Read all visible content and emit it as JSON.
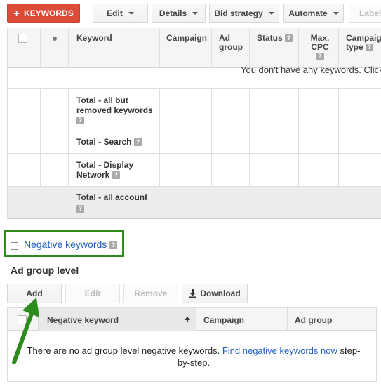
{
  "toolbar": {
    "keywords_label": "KEYWORDS",
    "edit_label": "Edit",
    "details_label": "Details",
    "bid_strategy_label": "Bid strategy",
    "automate_label": "Automate",
    "labels_label": "Labels"
  },
  "keywords_table": {
    "columns": {
      "keyword": "Keyword",
      "campaign": "Campaign",
      "ad_group": "Ad group",
      "status": "Status",
      "max_cpc": "Max. CPC",
      "campaign_type": "Campaign type"
    },
    "empty_message": "You don't have any keywords. Click",
    "totals": {
      "all_but_removed": "Total - all but removed keywords",
      "search": "Total - Search",
      "display": "Total - Display Network",
      "account": "Total - all account"
    }
  },
  "negative_keywords": {
    "link_label": "Negative keywords",
    "section_title": "Ad group level",
    "add_label": "Add",
    "edit_label": "Edit",
    "remove_label": "Remove",
    "download_label": "Download",
    "columns": {
      "negative_keyword": "Negative keyword",
      "campaign": "Campaign",
      "ad_group": "Ad group"
    },
    "empty_text": "There are no ad group level negative keywords.",
    "find_link": "Find negative keywords now",
    "empty_suffix": "step-by-step."
  },
  "colors": {
    "accent_red": "#dd4b39",
    "link_blue": "#1f5fbf",
    "highlight_green": "#2e8b1d"
  },
  "icons": [
    "plus-icon",
    "caret-down-icon",
    "help-icon",
    "collapse-icon",
    "download-icon",
    "sort-up-icon",
    "arrow-annotation"
  ]
}
